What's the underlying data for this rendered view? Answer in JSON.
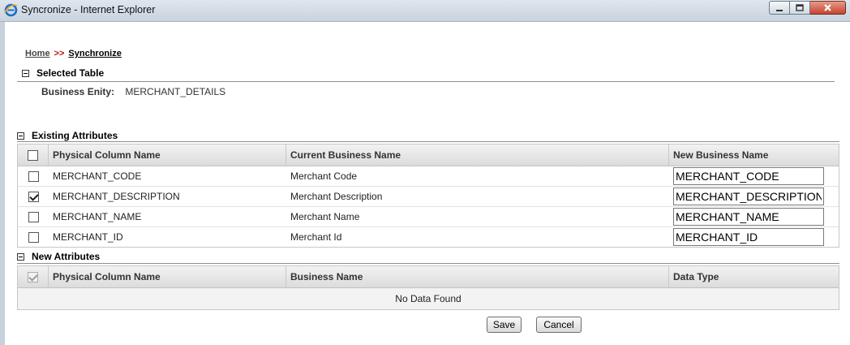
{
  "window": {
    "title": "Syncronize - Internet Explorer",
    "icon": "ie-icon",
    "controls": [
      "minimize-icon",
      "maximize-icon",
      "close-icon"
    ]
  },
  "breadcrumb": {
    "home": "Home",
    "separator": ">>",
    "current": "Synchronize"
  },
  "selected_table": {
    "heading": "Selected Table",
    "entity_label": "Business Enity:",
    "entity_value": "MERCHANT_DETAILS"
  },
  "existing_attributes": {
    "heading": "Existing Attributes",
    "columns": [
      "Physical Column Name",
      "Current Business Name",
      "New Business Name"
    ],
    "rows": [
      {
        "checked": false,
        "physical": "MERCHANT_CODE",
        "current": "Merchant Code",
        "new_name": "MERCHANT_CODE"
      },
      {
        "checked": true,
        "physical": "MERCHANT_DESCRIPTION",
        "current": "Merchant Description",
        "new_name": "MERCHANT_DESCRIPTION"
      },
      {
        "checked": false,
        "physical": "MERCHANT_NAME",
        "current": "Merchant Name",
        "new_name": "MERCHANT_NAME"
      },
      {
        "checked": false,
        "physical": "MERCHANT_ID",
        "current": "Merchant Id",
        "new_name": "MERCHANT_ID"
      }
    ]
  },
  "new_attributes": {
    "heading": "New Attributes",
    "columns": [
      "Physical Column Name",
      "Business Name",
      "Data Type"
    ],
    "empty_message": "No Data Found"
  },
  "actions": {
    "save": "Save",
    "cancel": "Cancel"
  },
  "colors": {
    "breadcrumb_separator": "#b01414",
    "title_bar": "#d4dde7",
    "close_button": "#c4452c"
  }
}
